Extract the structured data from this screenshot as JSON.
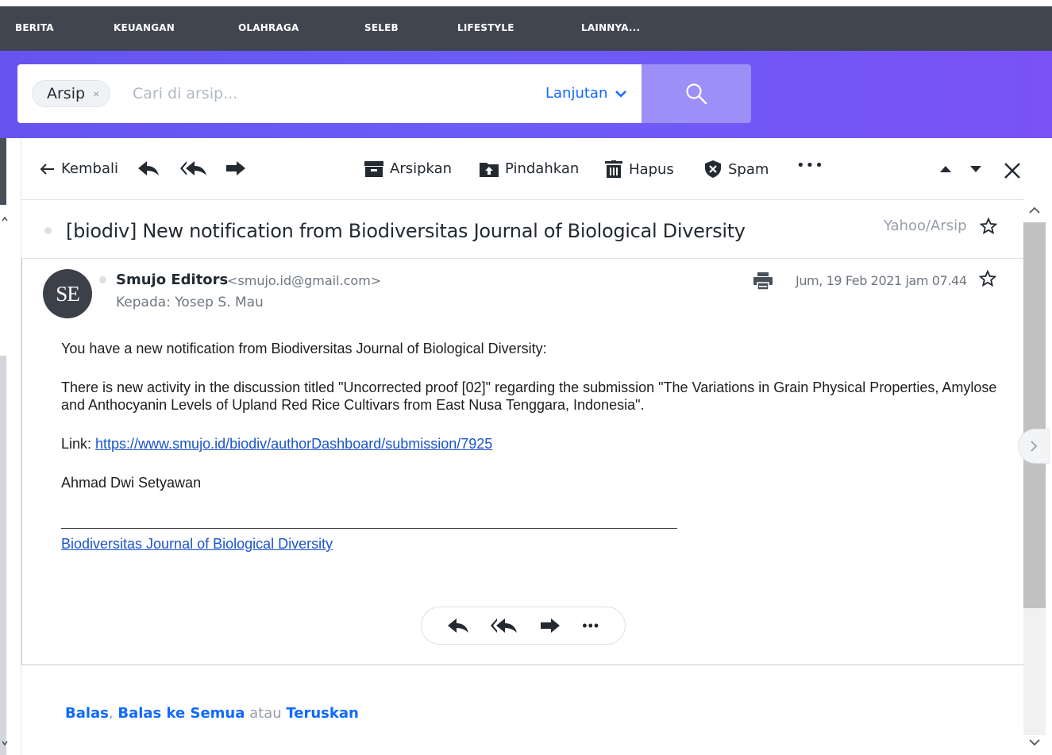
{
  "topnav": {
    "items": [
      "BERITA",
      "KEUANGAN",
      "OLAHRAGA",
      "SELEB",
      "LIFESTYLE",
      "LAINNYA..."
    ]
  },
  "search": {
    "chip_label": "Arsip",
    "chip_close": "×",
    "placeholder": "Cari di arsip...",
    "advanced_label": "Lanjutan",
    "search_icon": "search-icon"
  },
  "toolbar": {
    "back_label": "Kembali",
    "archive_label": "Arsipkan",
    "move_label": "Pindahkan",
    "delete_label": "Hapus",
    "spam_label": "Spam",
    "more_label": "•••"
  },
  "message": {
    "subject": "[biodiv] New notification from Biodiversitas Journal of Biological Diversity",
    "folder": "Yahoo/Arsip",
    "avatar_initials": "SE",
    "sender_name": "Smujo Editors",
    "sender_email": "<smujo.id@gmail.com>",
    "to_line": "Kepada: Yosep S. Mau",
    "date": "Jum, 19 Feb 2021 jam 07.44",
    "body": {
      "p1": "You have a new notification from Biodiversitas Journal of Biological Diversity:",
      "p2": "There is new activity in the discussion titled \"Uncorrected proof [02]\" regarding the submission \"The Variations in Grain Physical Properties, Amylose and Anthocyanin Levels of Upland Red Rice Cultivars from East Nusa Tenggara, Indonesia\".",
      "link_prefix": "Link: ",
      "link_url": "https://www.smujo.id/biodiv/authorDashboard/submission/7925",
      "signature": "Ahmad Dwi Setyawan",
      "footer_link": "Biodiversitas Journal of Biological Diversity"
    },
    "pill_more": "•••"
  },
  "footer": {
    "reply": "Balas",
    "comma": ",",
    "reply_all": "Balas ke Semua",
    "or": "atau",
    "forward": "Teruskan"
  },
  "colors": {
    "accent": "#0f69ff",
    "nav_bg": "#3f4650",
    "header_gradient_start": "#6554f0",
    "header_gradient_end": "#7a52f7",
    "search_button": "#9d8ff7"
  }
}
